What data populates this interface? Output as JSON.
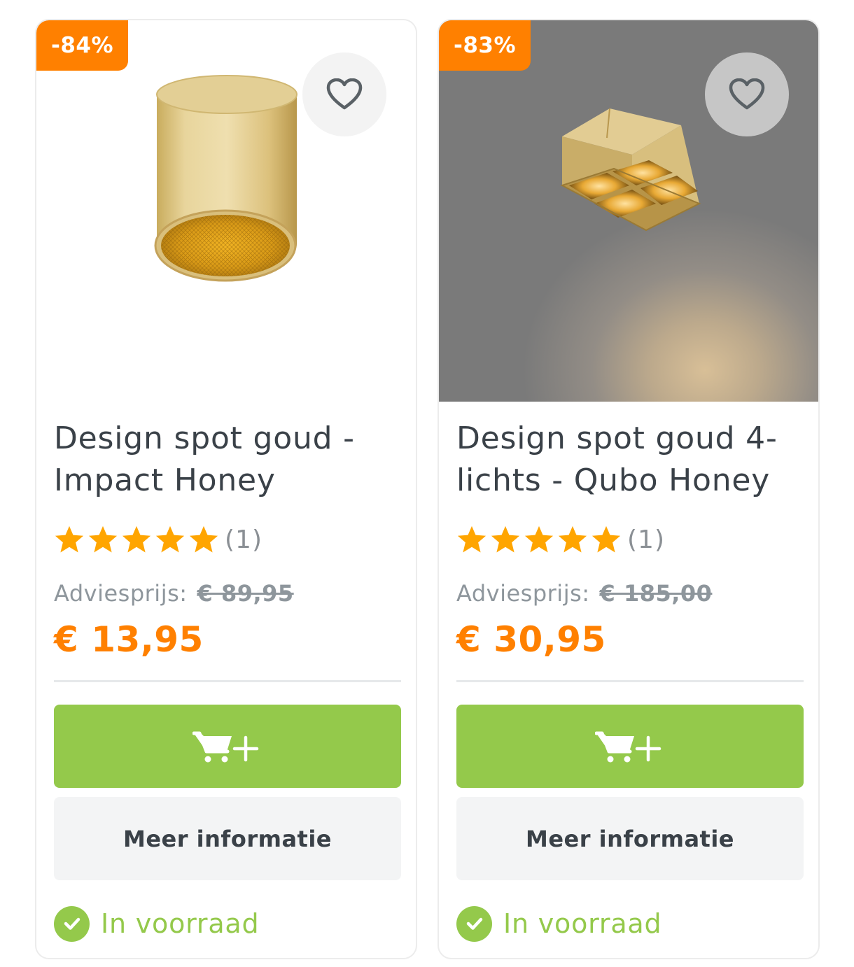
{
  "products": [
    {
      "discount_badge": "-84%",
      "title_line1": "Design spot goud -",
      "title_line2": "Impact Honey",
      "rating": 5,
      "review_count": "(1)",
      "advice_label": "Adviesprijs:",
      "advice_price": "€ 89,95",
      "price": "€ 13,95",
      "more_info_label": "Meer informatie",
      "stock_label": "In voorraad",
      "icons": [
        "heart-icon",
        "cart-plus-icon",
        "check-icon",
        "star-icon"
      ]
    },
    {
      "discount_badge": "-83%",
      "title_line1": "Design spot goud 4-",
      "title_line2": "lichts - Qubo Honey",
      "rating": 5,
      "review_count": "(1)",
      "advice_label": "Adviesprijs:",
      "advice_price": "€ 185,00",
      "price": "€ 30,95",
      "more_info_label": "Meer informatie",
      "stock_label": "In voorraad",
      "icons": [
        "heart-icon",
        "cart-plus-icon",
        "check-icon",
        "star-icon"
      ]
    }
  ],
  "colors": {
    "discount": "#ff8000",
    "price": "#ff8000",
    "cart_button": "#94c94b",
    "in_stock": "#94c94b",
    "star": "#ffa500",
    "text": "#3a4148"
  }
}
